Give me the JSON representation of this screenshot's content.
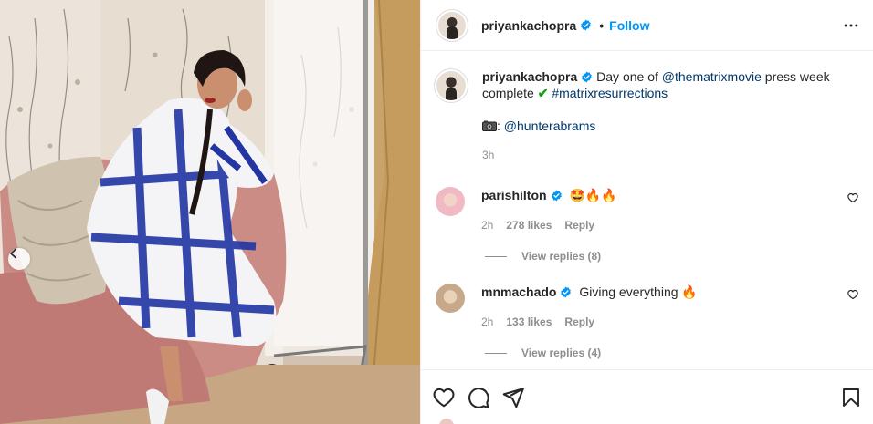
{
  "post": {
    "username": "priyankachopra",
    "follow_label": "Follow",
    "separator": "•"
  },
  "caption": {
    "username": "priyankachopra",
    "text_before": " Day one of ",
    "mention": "@thematrixmovie",
    "text_after": " press week complete ",
    "hashtag": "#matrixresurrections",
    "photo_prefix": ": ",
    "photo_credit": "@hunterabrams",
    "time": "3h"
  },
  "comments": [
    {
      "username": "parishilton",
      "text": "🤩🔥🔥",
      "time": "2h",
      "likes": "278 likes",
      "reply_label": "Reply",
      "view_replies": "View replies (8)"
    },
    {
      "username": "mnmachado",
      "text": "Giving everything 🔥",
      "time": "2h",
      "likes": "133 likes",
      "reply_label": "Reply",
      "view_replies": "View replies (4)"
    }
  ],
  "icons": {
    "more": "more-horizontal-icon",
    "like": "heart-icon",
    "comment": "comment-icon",
    "share": "send-icon",
    "save": "bookmark-icon",
    "prev": "chevron-left-icon",
    "verified": "verified-badge-icon"
  },
  "colors": {
    "link": "#00376b",
    "follow": "#0095f6",
    "verified": "#0095f6",
    "meta": "#8e8e8e"
  }
}
